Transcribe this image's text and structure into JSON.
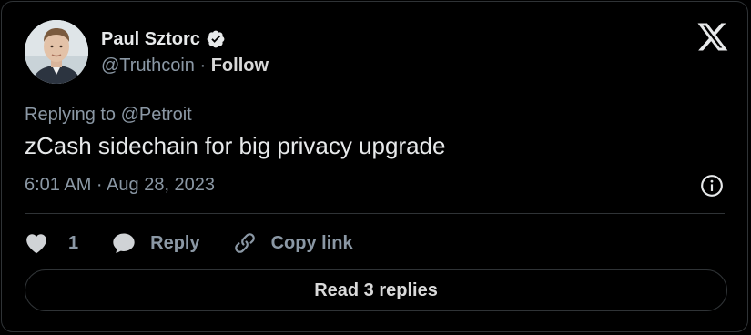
{
  "author": {
    "name": "Paul Sztorc",
    "handle": "@Truthcoin",
    "separator": "·",
    "follow_label": "Follow"
  },
  "tweet": {
    "replying_prefix": "Replying to ",
    "replying_to": "@Petroit",
    "text": "zCash sidechain for big privacy upgrade",
    "timestamp": "6:01 AM · Aug 28, 2023"
  },
  "actions": {
    "like_count": "1",
    "reply_label": "Reply",
    "copy_link_label": "Copy link"
  },
  "read_replies_label": "Read 3 replies",
  "icons": {
    "logo": "x-logo-icon",
    "verified": "verified-badge-icon",
    "info": "info-icon",
    "like": "heart-icon",
    "reply": "speech-bubble-icon",
    "copy_link": "link-icon"
  },
  "colors": {
    "background": "#000000",
    "text_primary": "#e7e9ea",
    "text_secondary": "#8b98a5",
    "border": "#2f3336"
  }
}
